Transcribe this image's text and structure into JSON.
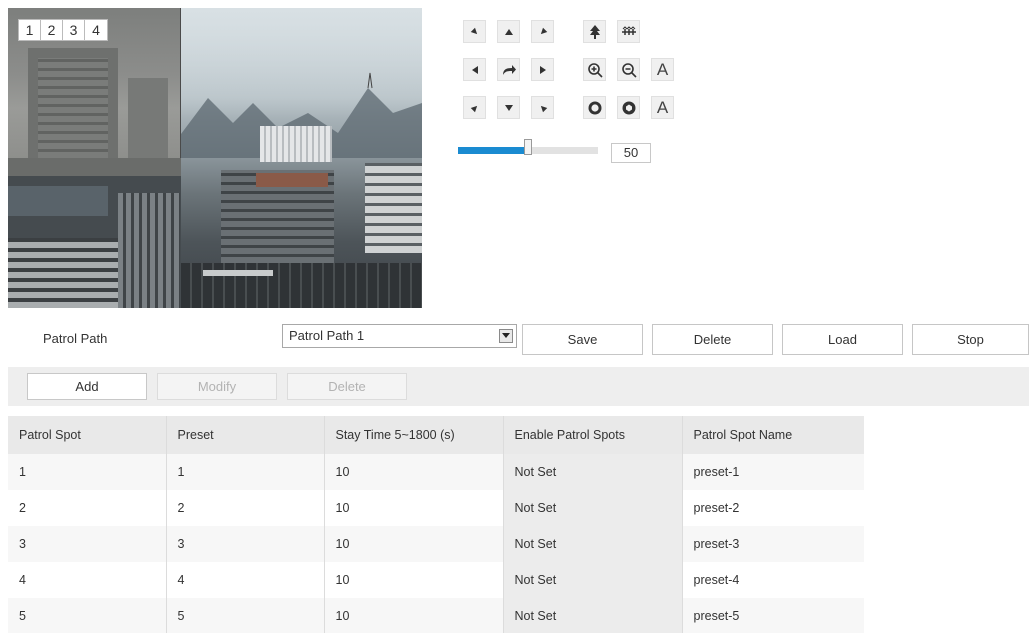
{
  "video": {
    "split_buttons": [
      "1",
      "2",
      "3",
      "4"
    ]
  },
  "ptz": {
    "buttons": [
      {
        "name": "ptz-up-left-icon"
      },
      {
        "name": "ptz-up-icon"
      },
      {
        "name": "ptz-up-right-icon"
      },
      {
        "name": "ptz-left-icon"
      },
      {
        "name": "ptz-auto-icon"
      },
      {
        "name": "ptz-right-icon"
      },
      {
        "name": "ptz-down-left-icon"
      },
      {
        "name": "ptz-down-icon"
      },
      {
        "name": "ptz-down-right-icon"
      },
      {
        "name": "focus-near-icon"
      },
      {
        "name": "focus-far-icon"
      },
      {
        "name": "zoom-in-icon"
      },
      {
        "name": "zoom-out-icon"
      },
      {
        "name": "zoom-auto-label"
      },
      {
        "name": "iris-open-icon"
      },
      {
        "name": "iris-close-icon"
      },
      {
        "name": "iris-auto-label"
      }
    ],
    "auto_label_1": "A",
    "auto_label_2": "A",
    "speed_value": "50",
    "speed_fraction": 0.5
  },
  "patrol": {
    "label": "Patrol Path",
    "selected": "Patrol Path 1",
    "save": "Save",
    "delete": "Delete",
    "load": "Load",
    "stop": "Stop"
  },
  "toolbar": {
    "add": "Add",
    "modify": "Modify",
    "delete": "Delete"
  },
  "table": {
    "headers": [
      "Patrol Spot",
      "Preset",
      "Stay Time 5~1800 (s)",
      "Enable Patrol Spots",
      "Patrol Spot Name"
    ],
    "rows": [
      [
        "1",
        "1",
        "10",
        "Not Set",
        "preset-1"
      ],
      [
        "2",
        "2",
        "10",
        "Not Set",
        "preset-2"
      ],
      [
        "3",
        "3",
        "10",
        "Not Set",
        "preset-3"
      ],
      [
        "4",
        "4",
        "10",
        "Not Set",
        "preset-4"
      ],
      [
        "5",
        "5",
        "10",
        "Not Set",
        "preset-5"
      ]
    ]
  },
  "colors": {
    "slider_fill": "#1a8bd1",
    "toolbar_bg": "#eeeeee",
    "header_bg": "#e9e9e9"
  }
}
